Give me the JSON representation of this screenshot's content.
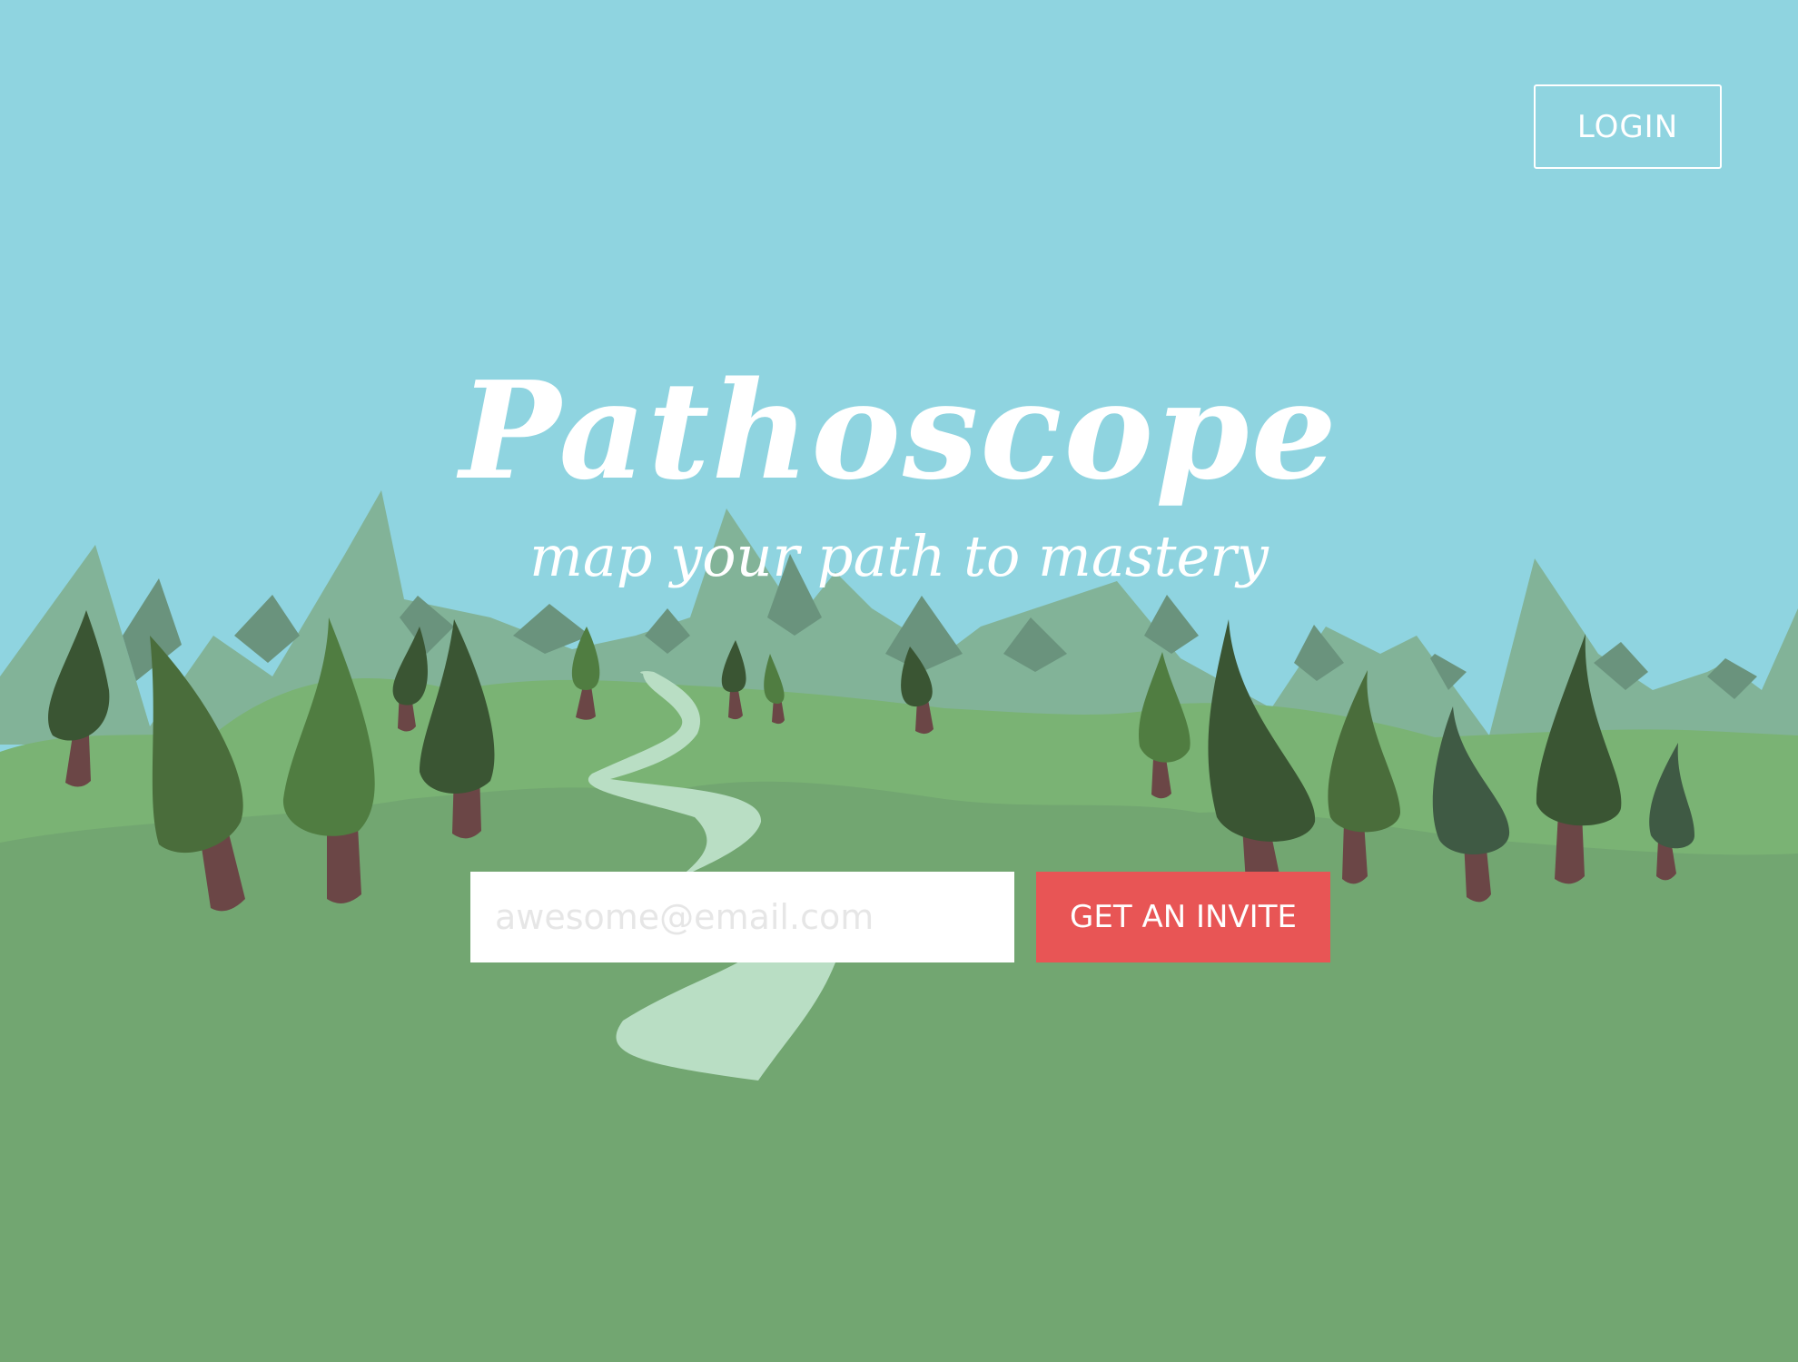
{
  "header": {
    "login_label": "LOGIN"
  },
  "hero": {
    "title": "Pathoscope",
    "tagline": "map your path to mastery"
  },
  "signup": {
    "email_placeholder": "awesome@email.com",
    "email_value": "",
    "invite_label": "GET AN INVITE"
  },
  "colors": {
    "sky": "#8fd4e0",
    "mountain_light": "#82b398",
    "mountain_dark": "#6a937d",
    "hill_back": "#7ab374",
    "ground": "#72a671",
    "path": "#b9dec4",
    "tree_dark": "#3a5533",
    "tree_mid": "#4a6d3b",
    "tree_light": "#507d41",
    "trunk": "#6b4646",
    "button_red": "#e85555"
  }
}
